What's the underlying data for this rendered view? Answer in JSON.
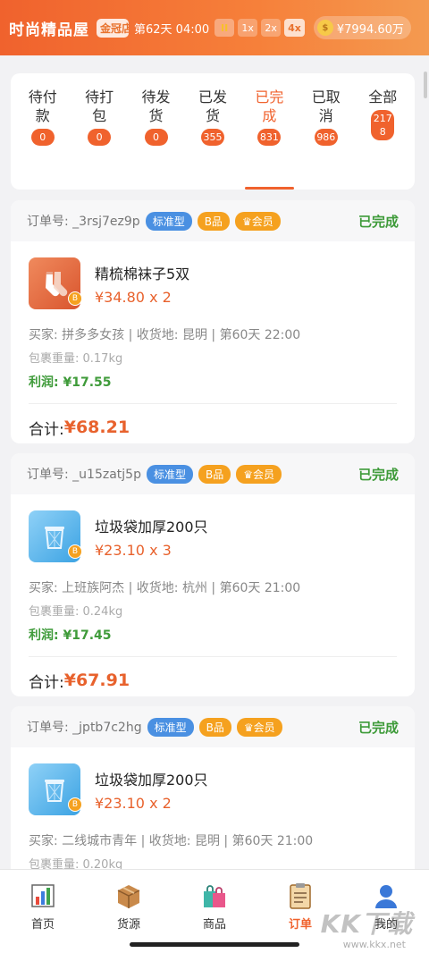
{
  "header": {
    "title": "时尚精品屋",
    "rank": "金冠店",
    "day_time": "第62天 04:00",
    "pause_label": "II",
    "speeds": [
      "1x",
      "2x",
      "4x"
    ],
    "money": "¥7994.60万"
  },
  "tabs": [
    {
      "label": "待付款",
      "count": "0"
    },
    {
      "label": "待打包",
      "count": "0"
    },
    {
      "label": "待发货",
      "count": "0"
    },
    {
      "label": "已发货",
      "count": "355"
    },
    {
      "label": "已完成",
      "count": "831"
    },
    {
      "label": "已取消",
      "count": "986"
    },
    {
      "label": "全部",
      "count": "2178"
    }
  ],
  "orders": [
    {
      "order_no": "订单号: _3rsj7ez9p",
      "tag_type": "标准型",
      "tag_grade": "B品",
      "tag_vip": "会员",
      "status": "已完成",
      "product_name": "精梳棉袜子5双",
      "price": "¥34.80 x 2",
      "meta": "买家: 拼多多女孩 | 收货地: 昆明 | 第60天 22:00",
      "weight": "包裹重量: 0.17kg",
      "profit": "利润: ¥17.55",
      "total_label": "合计: ",
      "total_value": "¥68.21"
    },
    {
      "order_no": "订单号: _u15zatj5p",
      "tag_type": "标准型",
      "tag_grade": "B品",
      "tag_vip": "会员",
      "status": "已完成",
      "product_name": "垃圾袋加厚200只",
      "price": "¥23.10 x 3",
      "meta": "买家: 上班族阿杰 | 收货地: 杭州 | 第60天 21:00",
      "weight": "包裹重量: 0.24kg",
      "profit": "利润: ¥17.45",
      "total_label": "合计: ",
      "total_value": "¥67.91"
    },
    {
      "order_no": "订单号: _jptb7c2hg",
      "tag_type": "标准型",
      "tag_grade": "B品",
      "tag_vip": "会员",
      "status": "已完成",
      "product_name": "垃圾袋加厚200只",
      "price": "¥23.10 x 2",
      "meta": "买家: 二线城市青年 | 收货地: 昆明 | 第60天 21:00",
      "weight": "包裹重量: 0.20kg"
    }
  ],
  "grade_badge": "B",
  "nav": [
    {
      "label": "首页",
      "icon": "bar-chart-icon"
    },
    {
      "label": "货源",
      "icon": "box-icon"
    },
    {
      "label": "商品",
      "icon": "shopping-bag-icon"
    },
    {
      "label": "订单",
      "icon": "clipboard-icon"
    },
    {
      "label": "我的",
      "icon": "user-icon"
    }
  ],
  "watermark": "KK下载",
  "watermark_url": "www.kkx.net",
  "colors": {
    "accent": "#f0622d",
    "success": "#3f9b3a",
    "tag_blue": "#4a90e2",
    "tag_orange": "#f5a11f"
  }
}
